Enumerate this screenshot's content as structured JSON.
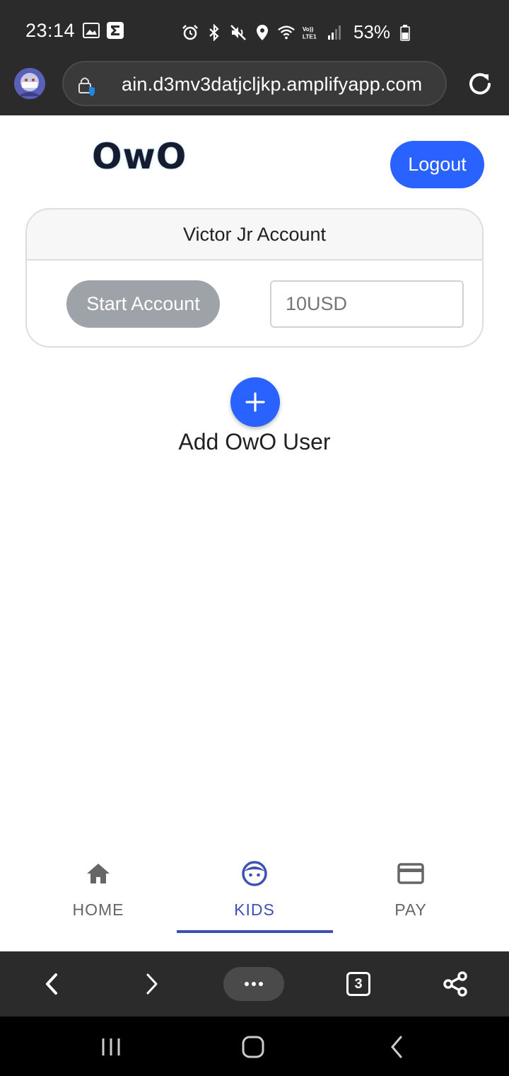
{
  "status_bar": {
    "time": "23:14",
    "battery": "53%",
    "icons": [
      "image-icon",
      "sigma-icon",
      "alarm-icon",
      "bluetooth-icon",
      "mute-icon",
      "location-icon",
      "wifi-icon",
      "volte-icon",
      "signal-icon",
      "battery-icon"
    ]
  },
  "browser": {
    "url": "ain.d3mv3datjcljkp.amplifyapp.com",
    "tab_count": "3"
  },
  "header": {
    "logo": "OwO",
    "logout_label": "Logout"
  },
  "account_card": {
    "title": "Victor Jr Account",
    "start_label": "Start Account",
    "amount_placeholder": "10USD"
  },
  "add_user": {
    "label": "Add OwO User"
  },
  "bottom_nav": {
    "items": [
      {
        "label": "HOME",
        "icon": "home-icon",
        "active": false
      },
      {
        "label": "KIDS",
        "icon": "face-icon",
        "active": true
      },
      {
        "label": "PAY",
        "icon": "credit-card-icon",
        "active": false
      }
    ]
  },
  "colors": {
    "primary": "#2962ff",
    "nav_active": "#3f51b5",
    "disabled_button": "#9ea3a9",
    "dark_bar": "#2b2b2b"
  }
}
